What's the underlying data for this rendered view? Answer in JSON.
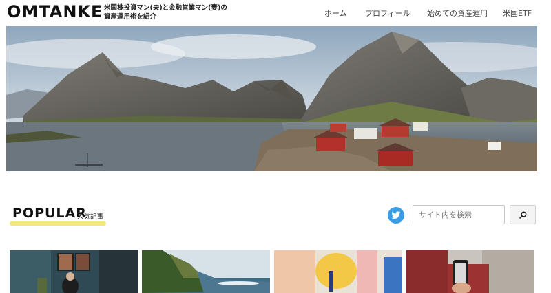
{
  "header": {
    "logo": "OMTANKE",
    "tagline": "米国株投資マン(夫)と金融営業マン(妻)の資産運用術を紹介",
    "nav": [
      {
        "label": "ホーム"
      },
      {
        "label": "プロフィール"
      },
      {
        "label": "始めての資産運用"
      },
      {
        "label": "米国ETF"
      }
    ]
  },
  "hero": {
    "icon": "mountain-fjord-photo"
  },
  "popular": {
    "title": "POPULAR",
    "subtitle": "人気記事"
  },
  "search": {
    "placeholder": "サイト内を検索",
    "button_icon": "search-icon",
    "twitter_icon": "twitter-icon"
  },
  "colors": {
    "accent_underline": "#f2e26a",
    "twitter_blue": "#3a9ee6"
  }
}
